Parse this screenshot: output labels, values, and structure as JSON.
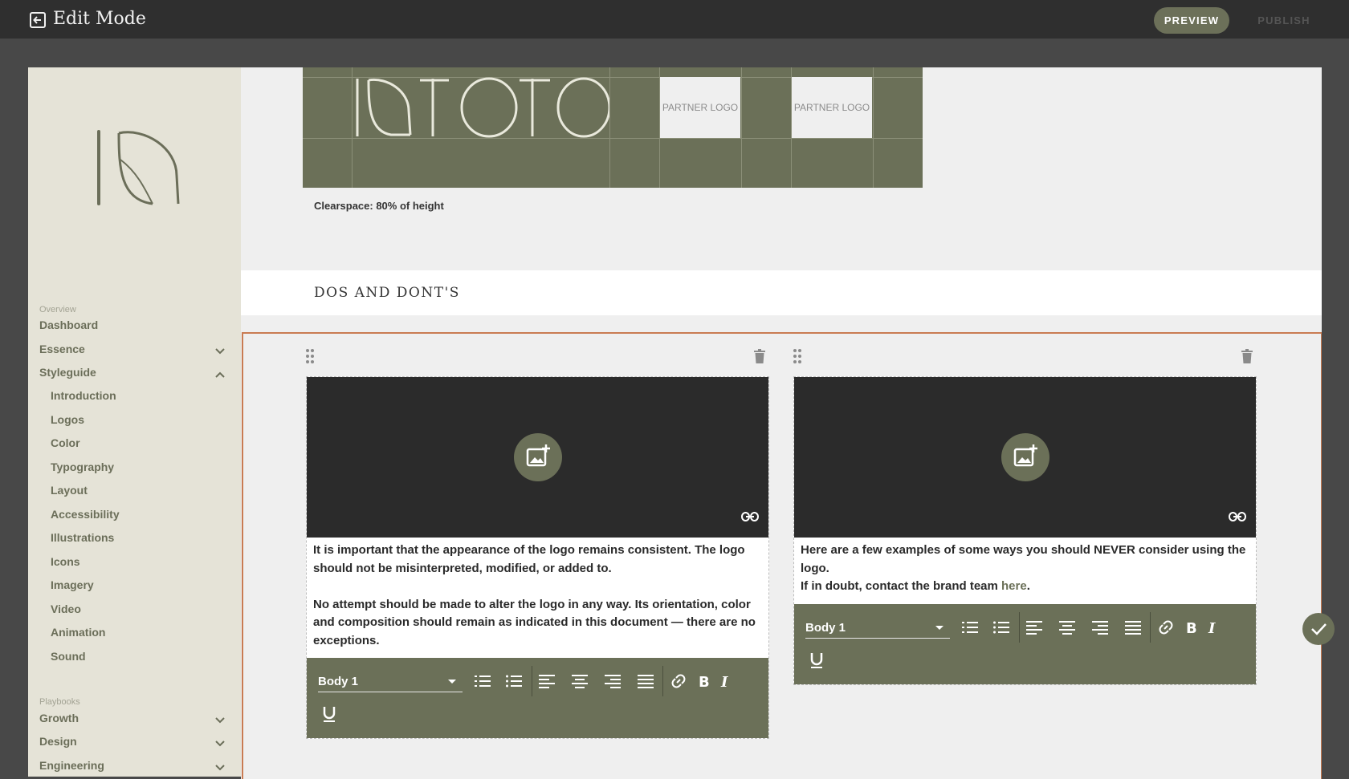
{
  "topbar": {
    "title": "Edit Mode",
    "preview_label": "PREVIEW",
    "publish_label": "PUBLISH"
  },
  "sidebar": {
    "overview_label": "Overview",
    "items": [
      {
        "label": "Dashboard"
      },
      {
        "label": "Essence"
      },
      {
        "label": "Styleguide"
      }
    ],
    "styleguide_children": [
      "Introduction",
      "Logos",
      "Color",
      "Typography",
      "Layout",
      "Accessibility",
      "Illustrations",
      "Icons",
      "Imagery",
      "Video",
      "Animation",
      "Sound"
    ],
    "playbooks_label": "Playbooks",
    "playbooks": [
      {
        "label": "Growth"
      },
      {
        "label": "Design"
      },
      {
        "label": "Engineering"
      }
    ]
  },
  "main": {
    "partner_logo_1": "PARTNER\nLOGO",
    "partner_logo_2": "PARTNER\nLOGO",
    "clearspace_caption": "Clearspace: 80% of height",
    "section_title": "DOS AND DONT'S",
    "cards": [
      {
        "text": "It is important that the appearance of the logo remains consistent. The logo should not be misinterpreted, modified, or added to.\n\nNo attempt should be made to alter the logo in any way. Its orientation, color and composition should remain as indicated in this document — there are no exceptions.",
        "style": "Body 1"
      },
      {
        "text_prefix": "Here are a few examples of some ways you should NEVER consider using the logo.\nIf in doubt, contact the brand team ",
        "link_text": "here",
        "text_suffix": ".",
        "style": "Body 1"
      }
    ]
  },
  "colors": {
    "accent": "#6b7058",
    "frame": "#c97b52",
    "sidebar": "#e5e3d7"
  }
}
